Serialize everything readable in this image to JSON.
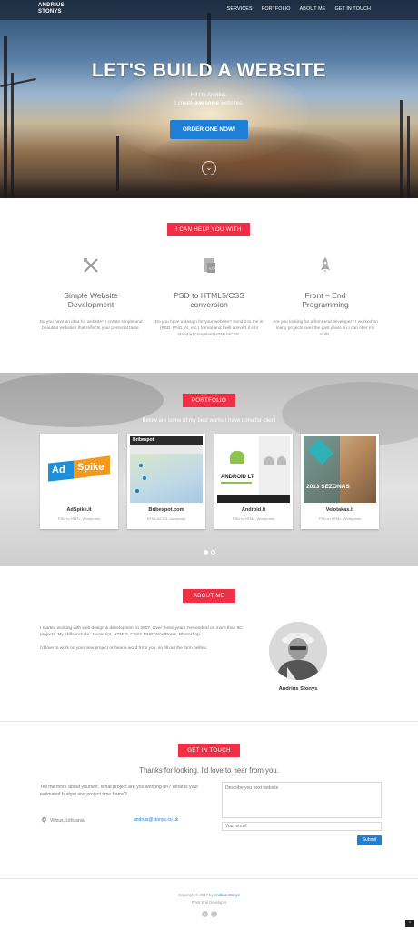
{
  "nav": {
    "logo_line1": "ANDRIUS",
    "logo_line2": "STONYS",
    "items": [
      "SERVICES",
      "PORTFOLIO",
      "ABOUT ME",
      "GET IN TOUCH"
    ]
  },
  "hero": {
    "title": "LET'S BUILD A WEBSITE",
    "line1": "Hi! I'm Andrius.",
    "line2_pre": "I create ",
    "line2_bold": "awesome",
    "line2_post": " websites.",
    "button": "ORDER ONE NOW!",
    "scroll_icon": "chevron-down-icon"
  },
  "services": {
    "label": "I CAN HELP YOU WITH",
    "items": [
      {
        "icon": "pencil-ruler-icon",
        "title1": "Simple Website",
        "title2": "Development",
        "text": "Do you have an idea for website? I create simple and beautiful websites that reflects your personal taste."
      },
      {
        "icon": "file-code-icon",
        "title1": "PSD to HTML5/CSS",
        "title2": "conversion",
        "text": "Do you have a design for your website? Send it to me in (PSD, PNG, AI, etc.) format and I will convert it into standart compliant HTML5/CSS."
      },
      {
        "icon": "rocket-icon",
        "title1": "Front – End",
        "title2": "Programming",
        "text": "Are you looking for a front-end developer? I worked on many projects over the past years so I can offer my skills."
      }
    ]
  },
  "portfolio": {
    "label": "PORTFOLIO",
    "subtitle": "Below are some of my best works I have done for client",
    "cards": [
      {
        "title": "AdSpike.lt",
        "tags": "PSD to HMTL, Wordpress",
        "thumb_text1": "Ad",
        "thumb_text2": "Spike"
      },
      {
        "title": "Bribespot.com",
        "tags": "HTML5/CSS, Javascript",
        "thumb_text1": "Bribespot"
      },
      {
        "title": "Android.lt",
        "tags": "PSD to HTML, Wordpress",
        "thumb_text1": "ANDROID LT"
      },
      {
        "title": "Velotakas.lt",
        "tags": "PSD to HTML, Wordpress",
        "thumb_text1": "2013 SEZONAS"
      }
    ]
  },
  "about": {
    "label": "ABOUT ME",
    "p1": "I started working with web design & development in 2007. Over these years I've worked on more than 50 projects. My skills include: Javascript, HTML5, CSS3, PHP, WordPress, Photoshop.",
    "p2": "I'd love to work on your new project or hear a word from you, so fill out the form bellow.",
    "name": "Andrius Stonys"
  },
  "contact": {
    "label": "GET IN TOUCH",
    "thanks": "Thanks for looking. I'd love to hear from you.",
    "text": "Tell me more about yourself. What project are you working on? What is your estimated budget and project time frame?",
    "location": "Vilnius, Lithuania",
    "email": "andrius@stonys.co.uk",
    "message_placeholder": "Describe you next website",
    "email_placeholder": "Your email",
    "submit": "Submit"
  },
  "footer": {
    "copyright_pre": "Copyright © 2017 by ",
    "copyright_name": "Andrius Stonys",
    "role": "Front End Developer",
    "social_icons": [
      "facebook-icon",
      "twitter-icon"
    ]
  },
  "colors": {
    "accent_red": "#ef2f45",
    "accent_blue": "#1e7fd6"
  }
}
